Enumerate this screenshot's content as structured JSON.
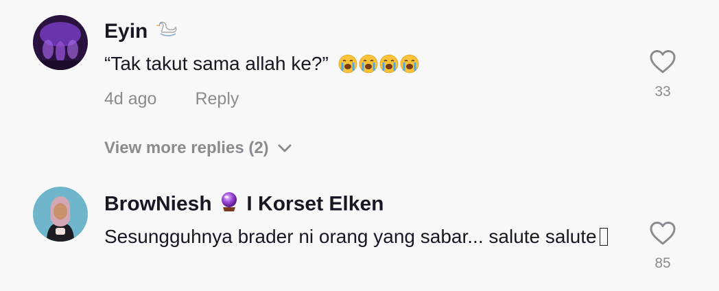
{
  "comments": [
    {
      "username": "Eyin",
      "username_emoji": "swan-icon",
      "text": "“Tak takut sama allah ke?”",
      "text_emojis": [
        "loudly-crying-face-icon",
        "loudly-crying-face-icon",
        "loudly-crying-face-icon",
        "loudly-crying-face-icon"
      ],
      "time": "4d ago",
      "reply_label": "Reply",
      "like_count": "33",
      "view_more": "View more replies (2)"
    },
    {
      "username": "BrowNiesh",
      "username_emoji": "crystal-ball-icon",
      "username_suffix": "I Korset Elken",
      "text": "Sesungguhnya brader ni orang yang sabar... salute salute",
      "like_count": "85"
    }
  ],
  "colors": {
    "background": "#f8f8f8",
    "primary_text": "#161823",
    "secondary_text": "#8a8b91"
  }
}
